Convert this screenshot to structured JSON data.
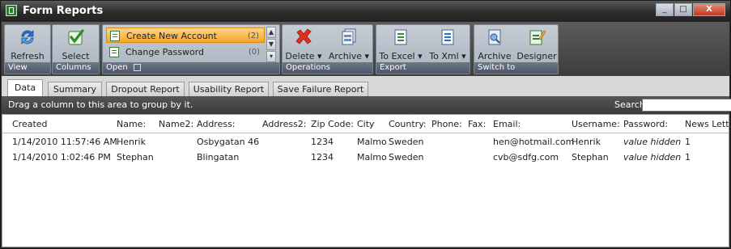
{
  "window": {
    "title": "Form Reports",
    "controls": [
      "_",
      "□",
      "X"
    ]
  },
  "ribbon": {
    "view": {
      "label": "View",
      "refresh": "Refresh"
    },
    "columns": {
      "label": "Columns",
      "select": "Select"
    },
    "open": {
      "label": "Open",
      "items": [
        {
          "label": "Create New Account",
          "count": "(2)"
        },
        {
          "label": "Change Password",
          "count": "(0)"
        }
      ]
    },
    "operations": {
      "label": "Operations",
      "delete": "Delete",
      "archive": "Archive"
    },
    "export": {
      "label": "Export",
      "to_excel": "To Excel",
      "to_xml": "To Xml"
    },
    "switch_to": {
      "label": "Switch to",
      "archive": "Archive",
      "designer": "Designer"
    }
  },
  "tabs": [
    {
      "label": "Data",
      "active": true
    },
    {
      "label": "Summary",
      "active": false
    },
    {
      "label": "Dropout Report",
      "active": false
    },
    {
      "label": "Usability Report",
      "active": false
    },
    {
      "label": "Save Failure Report",
      "active": false
    }
  ],
  "group_bar": {
    "hint": "Drag a column to this area to group by it.",
    "search_label": "Search:",
    "search_value": ""
  },
  "grid": {
    "columns": [
      "Created",
      "Name:",
      "Name2:",
      "Address:",
      "Address2:",
      "Zip Code:",
      "City",
      "Country:",
      "Phone:",
      "Fax:",
      "Email:",
      "Username:",
      "Password:",
      "News Letter:"
    ],
    "rows": [
      [
        "1/14/2010 11:57:46 AM",
        "Henrik",
        "",
        "Osbygatan 46",
        "",
        "1234",
        "Malmo",
        "Sweden",
        "",
        "",
        "hen@hotmail.com",
        "Henrik",
        "value hidden",
        "1"
      ],
      [
        "1/14/2010 1:02:46 PM",
        "Stephan",
        "",
        "Blingatan",
        "",
        "1234",
        "Malmo",
        "Sweden",
        "",
        "",
        "cvb@sdfg.com",
        "Stephan",
        "value hidden",
        "1"
      ]
    ]
  }
}
